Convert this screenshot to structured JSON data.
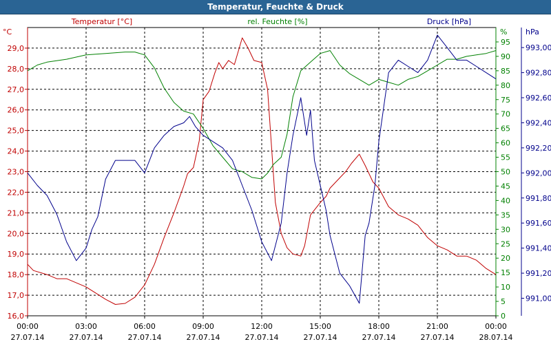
{
  "window": {
    "title": "Temperatur, Feuchte & Druck"
  },
  "chart_data": {
    "type": "line",
    "title": "Temperatur, Feuchte & Druck",
    "grid": true,
    "colors": {
      "temperature": "#c00000",
      "humidity": "#008000",
      "pressure": "#00008b",
      "grid": "#000000"
    },
    "x_ticks": [
      {
        "time": "00:00",
        "date": "27.07.14",
        "h": 0
      },
      {
        "time": "03:00",
        "date": "27.07.14",
        "h": 3
      },
      {
        "time": "06:00",
        "date": "27.07.14",
        "h": 6
      },
      {
        "time": "09:00",
        "date": "27.07.14",
        "h": 9
      },
      {
        "time": "12:00",
        "date": "27.07.14",
        "h": 12
      },
      {
        "time": "15:00",
        "date": "27.07.14",
        "h": 15
      },
      {
        "time": "18:00",
        "date": "27.07.14",
        "h": 18
      },
      {
        "time": "21:00",
        "date": "27.07.14",
        "h": 21
      },
      {
        "time": "00:00",
        "date": "28.07.14",
        "h": 24
      }
    ],
    "axes": {
      "temperature": {
        "name": "Temperatur [°C]",
        "unit": "°C",
        "ylim": [
          16,
          30
        ],
        "ticks": [
          "16,0",
          "17,0",
          "18,0",
          "19,0",
          "20,0",
          "21,0",
          "22,0",
          "23,0",
          "24,0",
          "25,0",
          "26,0",
          "27,0",
          "28,0",
          "29,0"
        ]
      },
      "humidity": {
        "name": "rel. Feuchte [%]",
        "unit": "%",
        "ylim": [
          0,
          100
        ],
        "ticks": [
          "0",
          "5",
          "10",
          "15",
          "20",
          "25",
          "30",
          "35",
          "40",
          "45",
          "50",
          "55",
          "60",
          "65",
          "70",
          "75",
          "80",
          "85",
          "90",
          "95"
        ]
      },
      "pressure": {
        "name": "Druck [hPa]",
        "unit": "hPa",
        "ylim": [
          990.86,
          993.16
        ],
        "ticks": [
          "991,00",
          "991,20",
          "991,40",
          "991,60",
          "991,80",
          "992,00",
          "992,20",
          "992,40",
          "992,60",
          "992,80",
          "993,00"
        ]
      }
    },
    "series": [
      {
        "name": "Temperatur [°C]",
        "axis": "temperature",
        "x": [
          0,
          0.3,
          1,
          1.5,
          2,
          2.5,
          3,
          3.5,
          4,
          4.5,
          5,
          5.5,
          6,
          6.5,
          7,
          7.5,
          8,
          8.2,
          8.5,
          8.8,
          9,
          9.3,
          9.6,
          9.8,
          10,
          10.3,
          10.6,
          11,
          11.3,
          11.6,
          12,
          12.3,
          12.7,
          13,
          13.3,
          13.6,
          14,
          14.2,
          14.5,
          15,
          15.3,
          15.5,
          16,
          16.3,
          16.6,
          17,
          17.3,
          17.7,
          18,
          18.5,
          19,
          19.5,
          20,
          20.5,
          21,
          21.5,
          22,
          22.5,
          23,
          23.5,
          24
        ],
        "values": [
          18.5,
          18.2,
          18.0,
          17.8,
          17.8,
          17.6,
          17.4,
          17.1,
          16.8,
          16.55,
          16.6,
          16.9,
          17.5,
          18.5,
          19.8,
          21.0,
          22.3,
          22.9,
          23.2,
          24.5,
          26.5,
          26.9,
          27.8,
          28.3,
          28.0,
          28.4,
          28.2,
          29.5,
          29.0,
          28.4,
          28.3,
          27.0,
          21.5,
          20.0,
          19.3,
          19.0,
          18.9,
          19.4,
          20.9,
          21.5,
          21.8,
          22.2,
          22.7,
          23.0,
          23.4,
          23.85,
          23.3,
          22.5,
          22.2,
          21.3,
          20.9,
          20.7,
          20.4,
          19.8,
          19.4,
          19.2,
          18.9,
          18.9,
          18.7,
          18.3,
          18.0
        ]
      },
      {
        "name": "rel. Feuchte [%]",
        "axis": "humidity",
        "x": [
          0,
          0.5,
          1,
          2,
          3,
          4,
          5,
          5.5,
          6,
          6.5,
          7,
          7.5,
          8,
          8.5,
          9,
          9.5,
          10,
          10.5,
          11,
          11.5,
          12,
          12.3,
          12.6,
          13,
          13.3,
          13.6,
          14,
          14.5,
          15,
          15.5,
          16,
          16.5,
          17,
          17.5,
          18,
          18.5,
          19,
          19.5,
          20,
          20.5,
          21,
          21.5,
          22,
          22.5,
          23,
          23.5,
          24
        ],
        "values": [
          85,
          87,
          88,
          89,
          90.5,
          91,
          91.5,
          91.5,
          90.5,
          86,
          79,
          74,
          71,
          70,
          65,
          59,
          55,
          51,
          50,
          48,
          47.5,
          49.5,
          52.5,
          55,
          63,
          76,
          85,
          88,
          91,
          92,
          87,
          84,
          82,
          80,
          82,
          81,
          80,
          82,
          83,
          85,
          87,
          89,
          89,
          90,
          90.5,
          91,
          92
        ]
      },
      {
        "name": "Druck [hPa]",
        "axis": "pressure",
        "x": [
          0,
          0.5,
          1,
          1.5,
          2,
          2.5,
          3,
          3.3,
          3.6,
          4,
          4.5,
          5,
          5.5,
          6,
          6.5,
          7,
          7.5,
          8,
          8.3,
          8.6,
          9,
          9.5,
          10,
          10.5,
          11,
          11.5,
          12,
          12.5,
          13,
          13.3,
          13.6,
          14,
          14.3,
          14.5,
          14.7,
          15,
          15.3,
          15.5,
          16,
          16.5,
          17,
          17.3,
          17.5,
          17.8,
          18,
          18.5,
          19,
          19.5,
          20,
          20.5,
          21,
          21.5,
          22,
          22.5,
          23,
          23.5,
          24
        ],
        "values": [
          992.0,
          991.9,
          991.82,
          991.67,
          991.45,
          991.3,
          991.4,
          991.55,
          991.65,
          991.95,
          992.1,
          992.1,
          992.1,
          992.0,
          992.2,
          992.3,
          992.37,
          992.4,
          992.45,
          992.37,
          992.3,
          992.25,
          992.2,
          992.1,
          991.9,
          991.7,
          991.45,
          991.3,
          991.6,
          992.0,
          992.3,
          992.6,
          992.3,
          992.5,
          992.1,
          991.9,
          991.7,
          991.5,
          991.2,
          991.1,
          990.96,
          991.5,
          991.6,
          991.9,
          992.25,
          992.8,
          992.9,
          992.85,
          992.8,
          992.9,
          993.1,
          993.0,
          992.9,
          992.9,
          992.85,
          992.8,
          992.75
        ]
      }
    ]
  }
}
